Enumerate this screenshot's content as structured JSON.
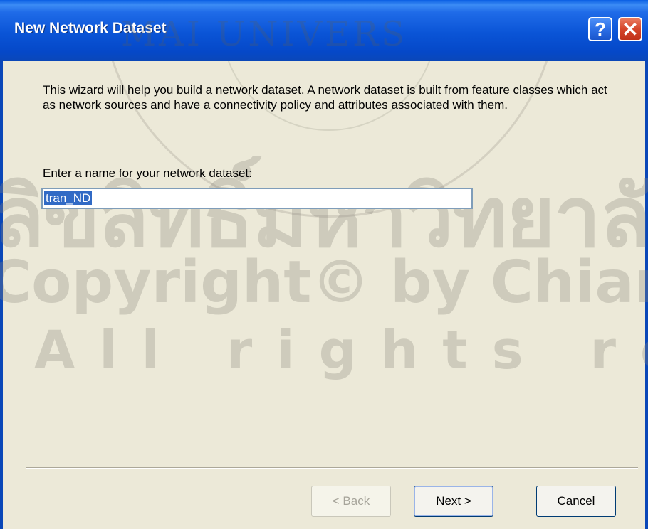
{
  "window": {
    "title": "New Network Dataset",
    "help_glyph": "?",
    "close_glyph": "✕"
  },
  "content": {
    "intro_text": "This wizard will help you build a network dataset.  A network dataset is built from feature classes which act as network sources and have a connectivity policy and attributes associated with them.",
    "name_prompt": "Enter a name for your network dataset:",
    "name_value": "tran_ND"
  },
  "buttons": {
    "back_prefix": "< ",
    "back_mnemonic": "B",
    "back_rest": "ack",
    "next_mnemonic": "N",
    "next_rest": "ext >",
    "cancel": "Cancel"
  },
  "watermark": {
    "seal_text": "MAI UNIVERS",
    "thai": "ลิขสิทธิ์มหาวิทยาลัยเชียงใหม่",
    "copyright": "Copyright© by Chiang Mai University",
    "rights": "All rights reserved"
  },
  "colors": {
    "title_bar": "#0a54d6",
    "dialog_bg": "#ece9d8",
    "selection": "#316ac5"
  }
}
